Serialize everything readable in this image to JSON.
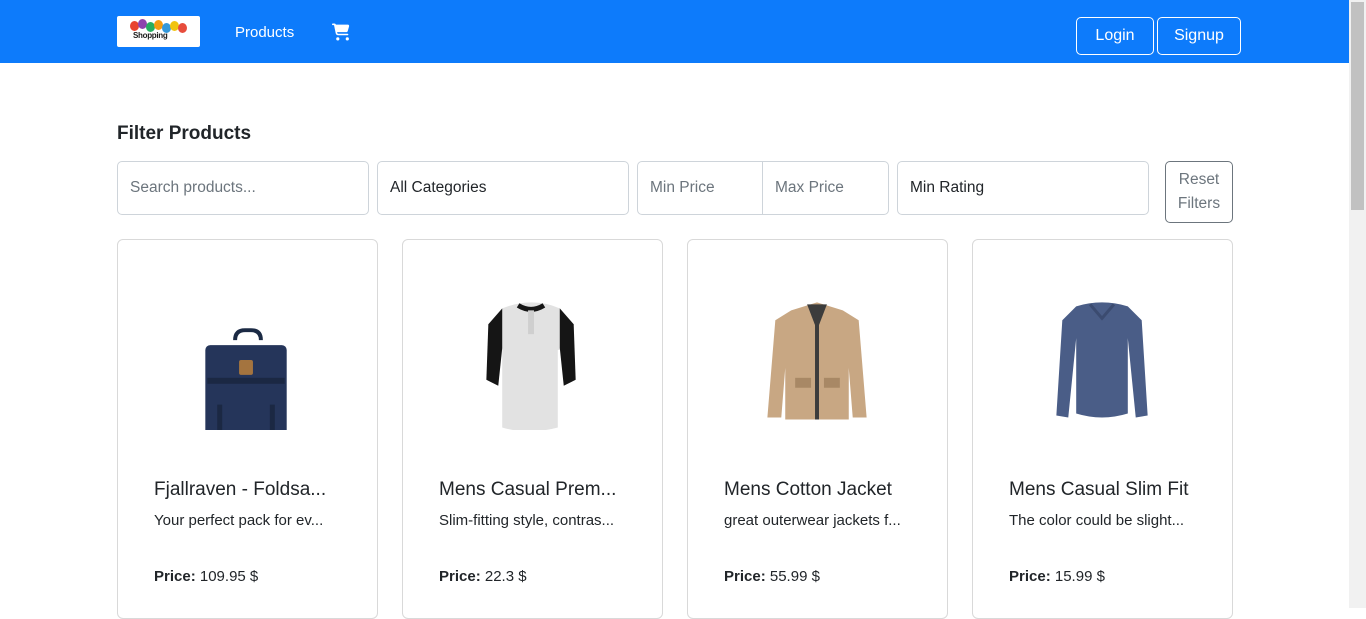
{
  "navbar": {
    "logo_text": "Shopping",
    "products_link": "Products",
    "login": "Login",
    "signup": "Signup"
  },
  "filters": {
    "title": "Filter Products",
    "search_placeholder": "Search products...",
    "category": "All Categories",
    "min_price_placeholder": "Min Price",
    "max_price_placeholder": "Max Price",
    "min_rating": "Min Rating",
    "reset_line1": "Reset",
    "reset_line2": "Filters"
  },
  "price_label": "Price:",
  "products": [
    {
      "title": "Fjallraven - Foldsa...",
      "desc": "Your perfect pack for ev...",
      "price": "109.95 $",
      "image": "backpack-image"
    },
    {
      "title": "Mens Casual Prem...",
      "desc": "Slim-fitting style, contras...",
      "price": "22.3 $",
      "image": "raglan-tshirt-image"
    },
    {
      "title": "Mens Cotton Jacket",
      "desc": "great outerwear jackets f...",
      "price": "55.99 $",
      "image": "cotton-jacket-image"
    },
    {
      "title": "Mens Casual Slim Fit",
      "desc": "The color could be slight...",
      "price": "15.99 $",
      "image": "slim-fit-shirt-image"
    }
  ],
  "colors": {
    "navbar": "#0d7bfb"
  }
}
